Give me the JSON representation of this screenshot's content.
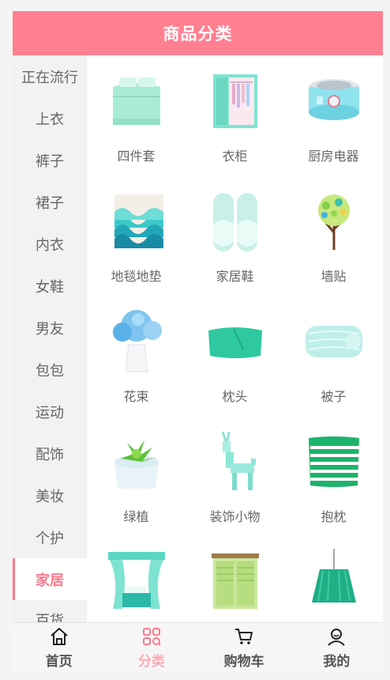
{
  "header": {
    "title": "商品分类"
  },
  "sidebar": {
    "items": [
      {
        "label": "正在流行"
      },
      {
        "label": "上衣"
      },
      {
        "label": "裤子"
      },
      {
        "label": "裙子"
      },
      {
        "label": "内衣"
      },
      {
        "label": "女鞋"
      },
      {
        "label": "男友"
      },
      {
        "label": "包包"
      },
      {
        "label": "运动"
      },
      {
        "label": "配饰"
      },
      {
        "label": "美妆"
      },
      {
        "label": "个护"
      },
      {
        "label": "家居"
      },
      {
        "label": "百货"
      }
    ],
    "active": "家居"
  },
  "grid": {
    "items": [
      {
        "label": "四件套",
        "icon": "bedding-set-icon"
      },
      {
        "label": "衣柜",
        "icon": "wardrobe-icon"
      },
      {
        "label": "厨房电器",
        "icon": "kitchen-appliance-icon"
      },
      {
        "label": "地毯地垫",
        "icon": "rug-icon"
      },
      {
        "label": "家居鞋",
        "icon": "slippers-icon"
      },
      {
        "label": "墙贴",
        "icon": "wall-sticker-icon"
      },
      {
        "label": "花束",
        "icon": "bouquet-icon"
      },
      {
        "label": "枕头",
        "icon": "pillow-icon"
      },
      {
        "label": "被子",
        "icon": "quilt-icon"
      },
      {
        "label": "绿植",
        "icon": "succulent-icon"
      },
      {
        "label": "装饰小物",
        "icon": "deer-ornament-icon"
      },
      {
        "label": "抱枕",
        "icon": "cushion-icon"
      },
      {
        "label": "",
        "icon": "curtain-icon"
      },
      {
        "label": "",
        "icon": "cabinet-icon"
      },
      {
        "label": "",
        "icon": "lamp-icon"
      }
    ]
  },
  "tabbar": {
    "items": [
      {
        "label": "首页",
        "icon": "home-icon"
      },
      {
        "label": "分类",
        "icon": "category-icon"
      },
      {
        "label": "购物车",
        "icon": "cart-icon"
      },
      {
        "label": "我的",
        "icon": "profile-icon"
      }
    ],
    "active": "分类"
  },
  "colors": {
    "brand": "#ff8090",
    "active": "#ff7a8c",
    "mint": "#6ee0c8"
  }
}
